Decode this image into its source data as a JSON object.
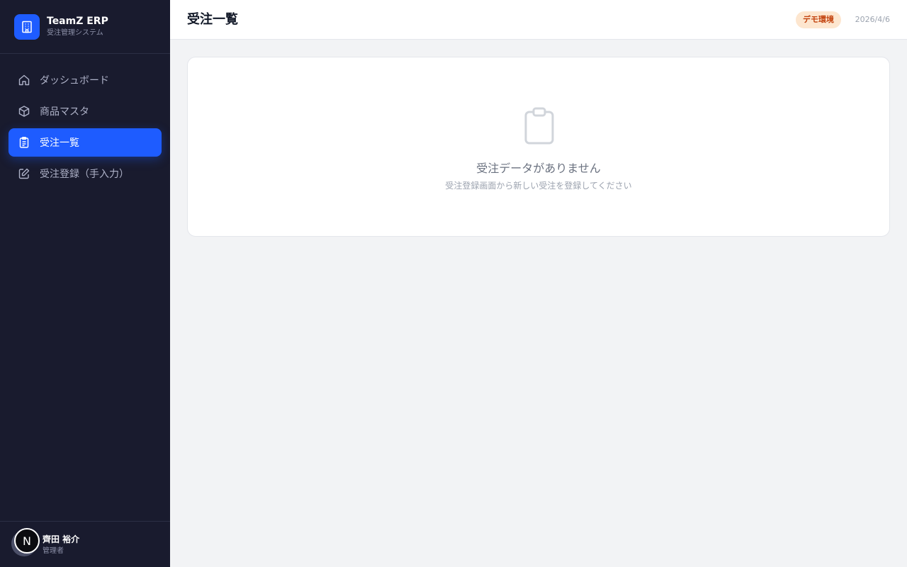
{
  "brand": {
    "name": "TeamZ ERP",
    "subtitle": "受注管理システム",
    "logo_icon": "building-icon"
  },
  "nav": [
    {
      "label": "ダッシュボード",
      "icon": "home-icon",
      "active": false
    },
    {
      "label": "商品マスタ",
      "icon": "box-icon",
      "active": false
    },
    {
      "label": "受注一覧",
      "icon": "clipboard-list-icon",
      "active": true
    },
    {
      "label": "受注登録（手入力）",
      "icon": "edit-icon",
      "active": false
    }
  ],
  "user": {
    "initial": "N",
    "name": "齊田 裕介",
    "role": "管理者"
  },
  "header": {
    "title": "受注一覧",
    "badge": "デモ環境",
    "date": "2026/4/6"
  },
  "empty_state": {
    "icon": "clipboard-icon",
    "title": "受注データがありません",
    "subtitle": "受注登録画面から新しい受注を登録してください"
  },
  "colors": {
    "sidebar_bg": "#191b2e",
    "accent": "#1e5cff",
    "badge_bg": "#fde6cf",
    "badge_text": "#c2410c"
  }
}
